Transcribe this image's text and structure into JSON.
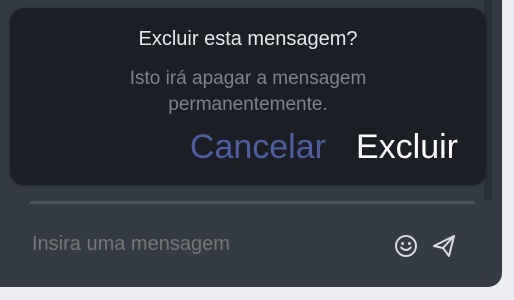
{
  "dialog": {
    "title": "Excluir esta mensagem?",
    "message": "Isto irá apagar a mensagem permanentemente.",
    "cancel_label": "Cancelar",
    "delete_label": "Excluir"
  },
  "composer": {
    "placeholder": "Insira uma mensagem",
    "emoji_icon": "emoji-icon",
    "send_icon": "send-icon"
  },
  "colors": {
    "background": "#343b44",
    "dialog": "#1b1f25",
    "cancel": "#4e5f9f",
    "delete": "#ffffff"
  }
}
